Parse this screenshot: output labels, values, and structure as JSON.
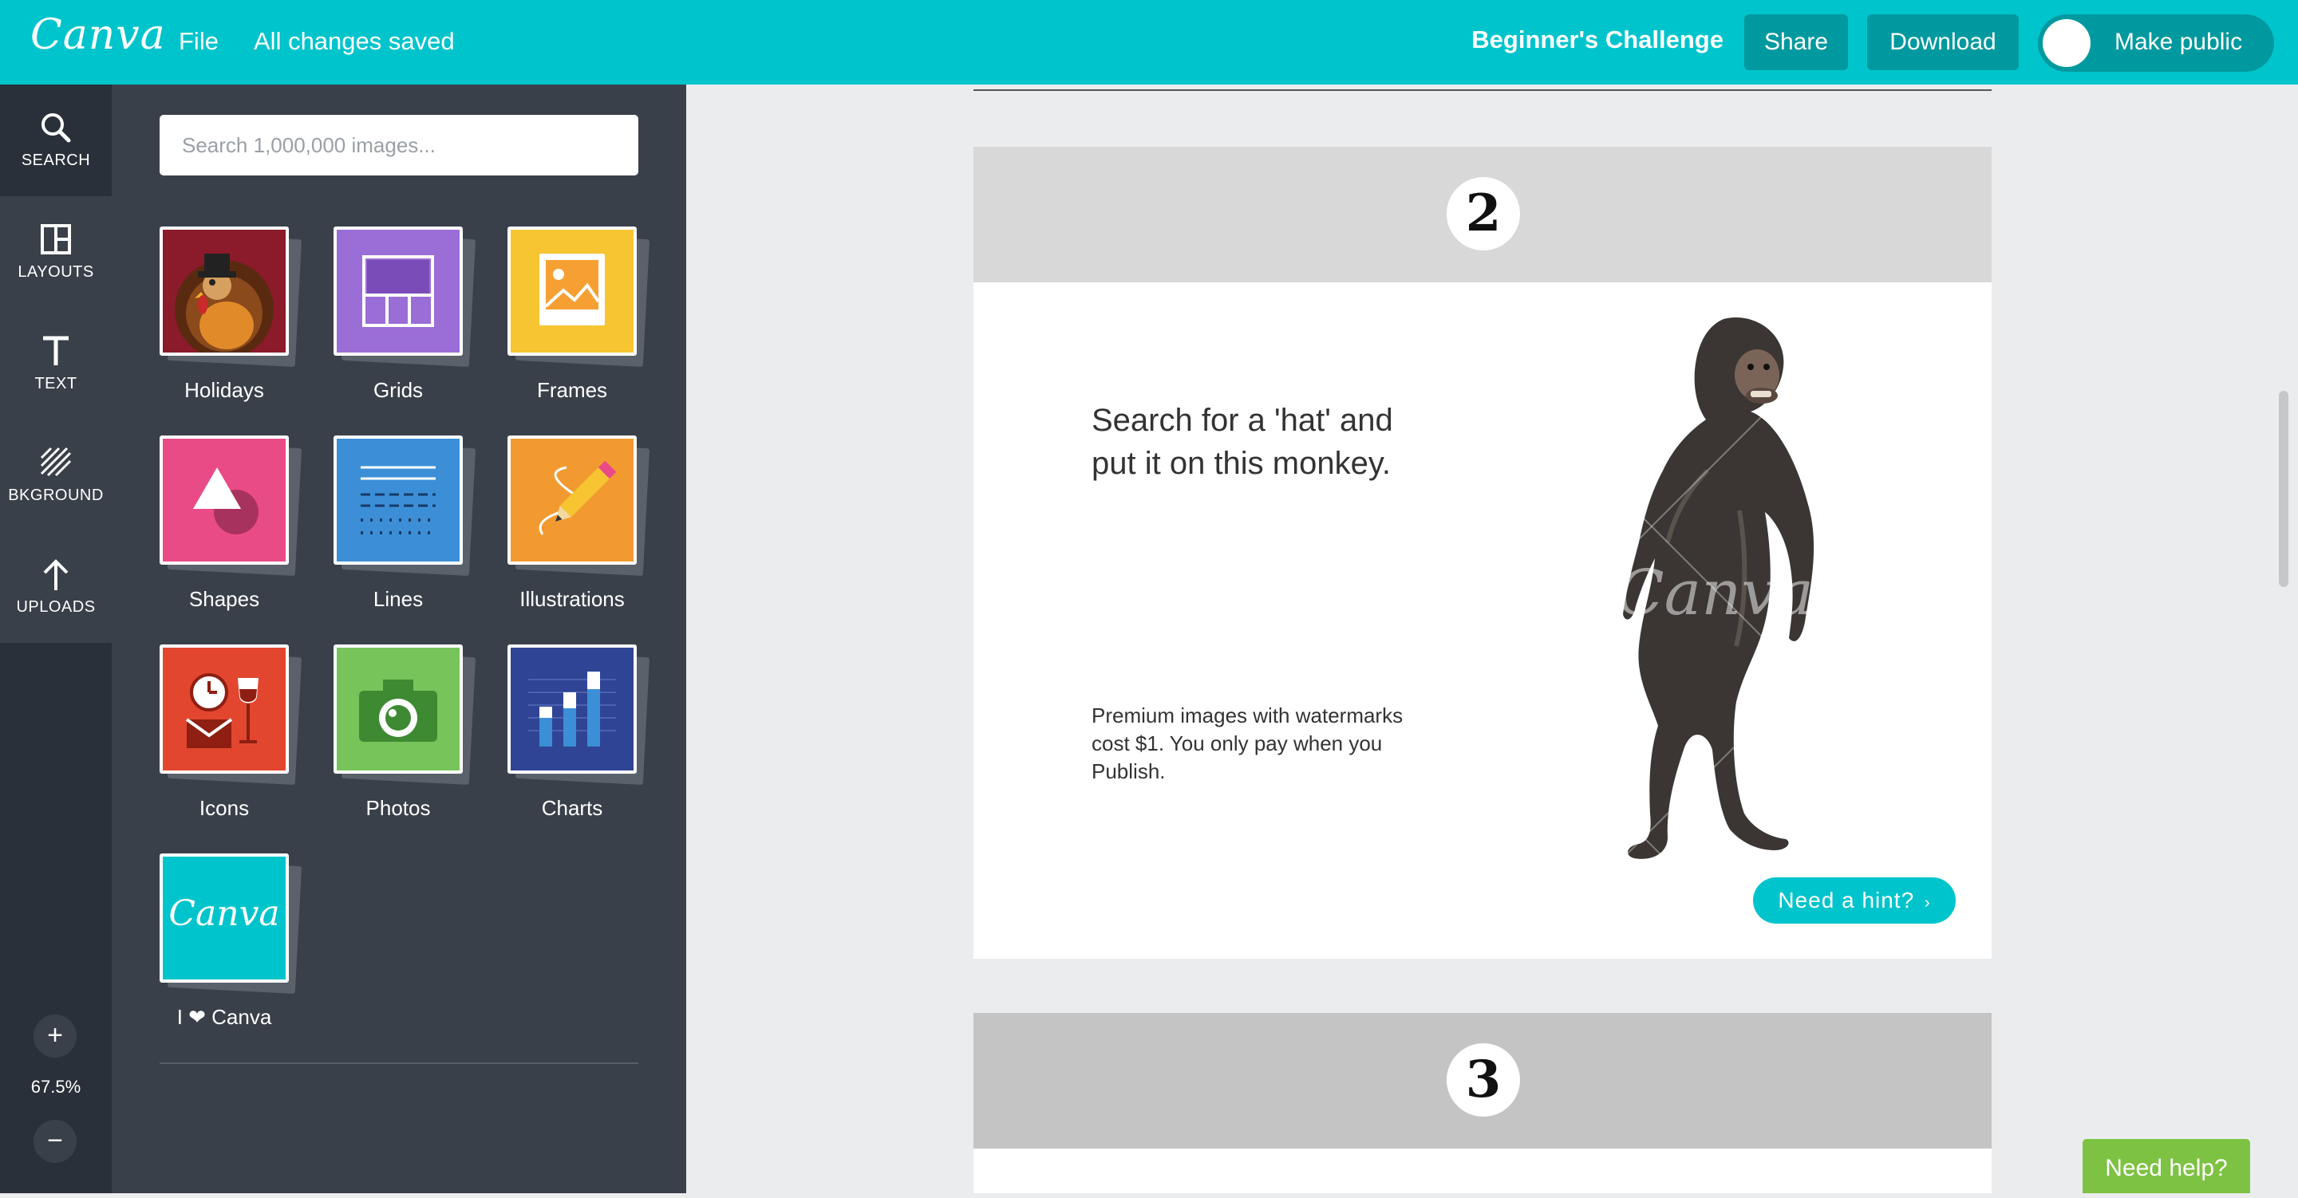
{
  "topbar": {
    "logo": "Canva",
    "file_menu": "File",
    "save_status": "All changes saved",
    "design_title": "Beginner's Challenge",
    "share_label": "Share",
    "download_label": "Download",
    "make_public_label": "Make public"
  },
  "leftnav": {
    "items": [
      {
        "label": "SEARCH",
        "icon": "search-icon"
      },
      {
        "label": "LAYOUTS",
        "icon": "layouts-icon"
      },
      {
        "label": "TEXT",
        "icon": "text-icon"
      },
      {
        "label": "BKGROUND",
        "icon": "background-icon"
      },
      {
        "label": "UPLOADS",
        "icon": "upload-icon"
      }
    ],
    "zoom_in": "+",
    "zoom_level": "67.5%",
    "zoom_out": "−"
  },
  "panel": {
    "search_placeholder": "Search 1,000,000 images...",
    "categories": [
      {
        "label": "Holidays",
        "color": "#8b1a2a"
      },
      {
        "label": "Grids",
        "color": "#9b6dd6"
      },
      {
        "label": "Frames",
        "color": "#f6c531"
      },
      {
        "label": "Shapes",
        "color": "#e94b87"
      },
      {
        "label": "Lines",
        "color": "#3c8fd6"
      },
      {
        "label": "Illustrations",
        "color": "#f29a30"
      },
      {
        "label": "Icons",
        "color": "#e2462f"
      },
      {
        "label": "Photos",
        "color": "#77c45a"
      },
      {
        "label": "Charts",
        "color": "#2f4494"
      },
      {
        "label": "I ❤ Canva",
        "color": "#00c4cc"
      }
    ]
  },
  "canvas": {
    "page2_number": "2",
    "page2_instruction": "Search for a 'hat' and put it on this monkey.",
    "page2_note": "Premium images with watermarks cost $1. You only pay when you Publish.",
    "watermark": "Canva",
    "hint_label": "Need a hint?",
    "page3_number": "3"
  },
  "help_label": "Need help?",
  "colors": {
    "brand": "#00c4cc",
    "sidebar": "#293039",
    "panel": "#3a4049",
    "help": "#7dc242"
  }
}
